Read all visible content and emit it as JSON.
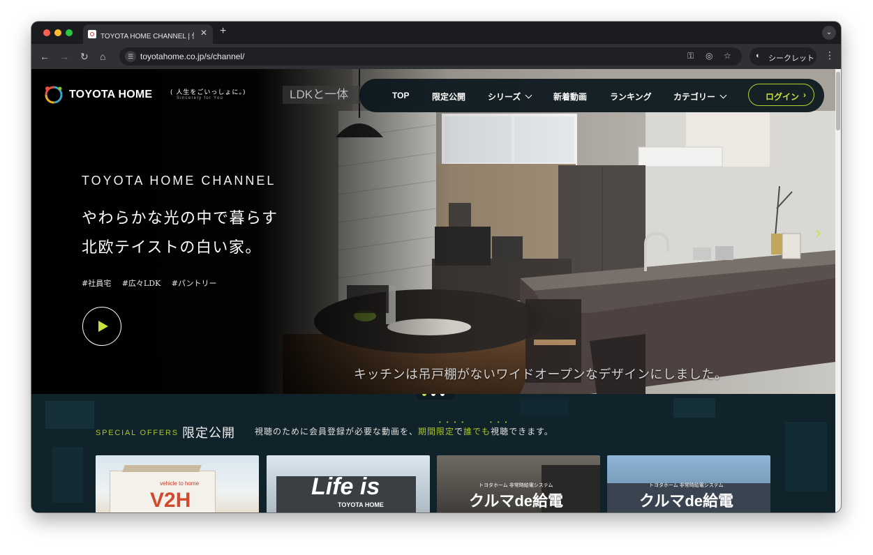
{
  "browser": {
    "tab_title": "TOYOTA HOME CHANNEL | 住",
    "tab_close": "✕",
    "new_tab": "+",
    "url": "toyotahome.co.jp/s/channel/",
    "incognito_label": "シークレット"
  },
  "site": {
    "logo_text": "TOYOTA HOME",
    "logo_tagline": "( 人生をごいっしょに。)",
    "logo_tagline_en": "Sincerely for You",
    "nav": [
      {
        "label": "TOP",
        "has_dropdown": false
      },
      {
        "label": "限定公開",
        "has_dropdown": false
      },
      {
        "label": "シリーズ",
        "has_dropdown": true
      },
      {
        "label": "新着動画",
        "has_dropdown": false
      },
      {
        "label": "ランキング",
        "has_dropdown": false
      },
      {
        "label": "カテゴリー",
        "has_dropdown": true
      }
    ],
    "login_label": "ログイン"
  },
  "hero": {
    "channel_title": "TOYOTA HOME CHANNEL",
    "headline_line1": "やわらかな光の中で暮らす",
    "headline_line2": "北欧テイストの白い家。",
    "tags": [
      "#社員宅",
      "#広々LDK",
      "#パントリー"
    ],
    "overlay_text": "LDKと一体",
    "video_caption": "キッチンは吊戸棚がないワイドオープンなデザインにしました。",
    "slide_count": 3,
    "active_slide": 1
  },
  "offers": {
    "label_en": "SPECIAL OFFERS",
    "title": "限定公開",
    "desc_pre": "視聴のために会員登録が必要な動画を、",
    "desc_hl1": "期間限定",
    "desc_mid": "で",
    "desc_hl2": "誰でも",
    "desc_post": "視聴できます。",
    "cards": [
      {
        "title": "V2H",
        "subtitle": "vehicle to home"
      },
      {
        "title": "Life is",
        "subtitle": "TOYOTA HOME"
      },
      {
        "title": "クルマde給電",
        "subtitle": "トヨタホーム 非常時給電システム"
      },
      {
        "title": "クルマde給電",
        "subtitle": "トヨタホーム 非常時給電システム"
      }
    ]
  },
  "colors": {
    "accent": "#c8e03c",
    "accent_muted": "#a8c42f",
    "page_bg": "#10232a"
  }
}
